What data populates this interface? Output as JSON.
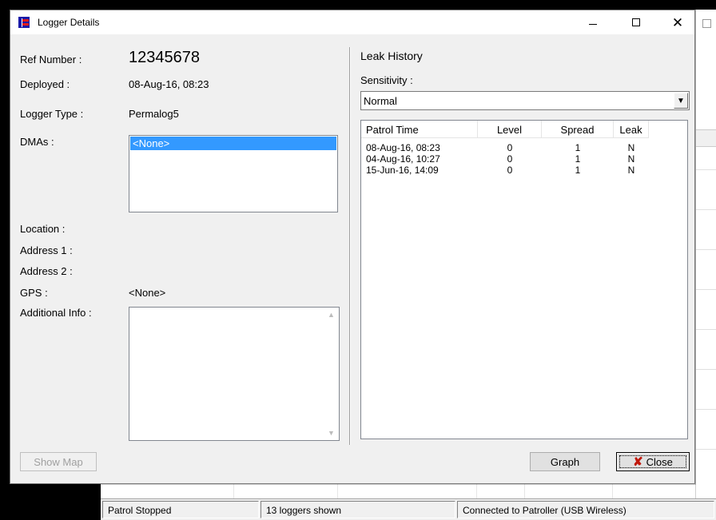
{
  "dialog": {
    "title": "Logger Details",
    "minimize_glyph": "—",
    "maximize_glyph": "☐",
    "close_glyph": "✕"
  },
  "details": {
    "ref_number_label": "Ref Number :",
    "ref_number_value": "12345678",
    "deployed_label": "Deployed :",
    "deployed_value": "08-Aug-16, 08:23",
    "logger_type_label": "Logger Type :",
    "logger_type_value": "Permalog5",
    "dmas_label": "DMAs :",
    "dmas_items": [
      "<None>"
    ],
    "location_label": "Location :",
    "address1_label": "Address 1 :",
    "address2_label": "Address 2 :",
    "gps_label": "GPS :",
    "gps_value": "<None>",
    "additional_info_label": "Additional Info :",
    "additional_info_value": "",
    "show_map_label": "Show Map"
  },
  "leak_history": {
    "heading": "Leak History",
    "sensitivity_label": "Sensitivity :",
    "sensitivity_value": "Normal",
    "columns": [
      "Patrol Time",
      "Level",
      "Spread",
      "Leak"
    ],
    "rows": [
      [
        "08-Aug-16, 08:23",
        "0",
        "1",
        "N"
      ],
      [
        "04-Aug-16, 10:27",
        "0",
        "1",
        "N"
      ],
      [
        "15-Jun-16, 14:09",
        "0",
        "1",
        "N"
      ]
    ],
    "graph_label": "Graph",
    "close_label": "Close"
  },
  "statusbar": {
    "patrol_status": "Patrol Stopped",
    "loggers_shown": "13 loggers shown",
    "connection": "Connected to Patroller (USB Wireless)"
  },
  "icons": {
    "close_x": "✘",
    "dropdown_arrow": "▼",
    "scroll_up": "▲",
    "scroll_down": "▼"
  },
  "colors": {
    "selection": "#3399ff",
    "close_icon": "#c0180b",
    "app_icon_blue": "#1a1aa8",
    "app_icon_red": "#e21b1b"
  }
}
